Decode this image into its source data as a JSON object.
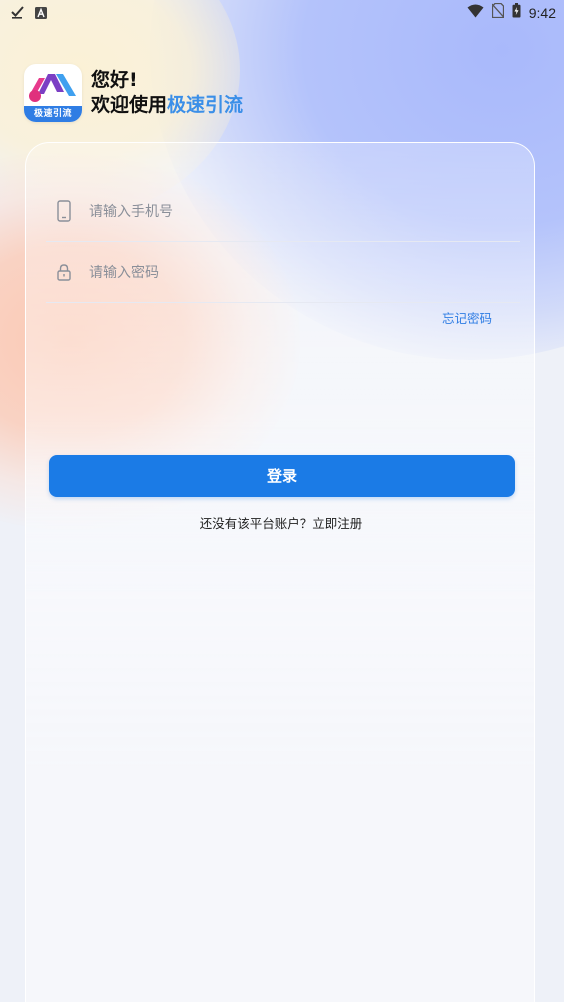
{
  "status_bar": {
    "time": "9:42",
    "left_icons": [
      "check-icon",
      "font-a-icon"
    ],
    "right_icons": [
      "wifi-icon",
      "no-sim-icon",
      "battery-icon"
    ]
  },
  "header": {
    "logo_text": "极速引流",
    "greeting_line1": "您好!",
    "greeting_prefix": "欢迎使用",
    "app_name": "极速引流"
  },
  "form": {
    "phone_placeholder": "请输入手机号",
    "password_placeholder": "请输入密码",
    "forgot_password": "忘记密码",
    "login_button": "登录",
    "register_prompt": "还没有该平台账户？立即注册"
  },
  "colors": {
    "accent": "#1b7be6",
    "brand_text": "#3b8fe8"
  }
}
